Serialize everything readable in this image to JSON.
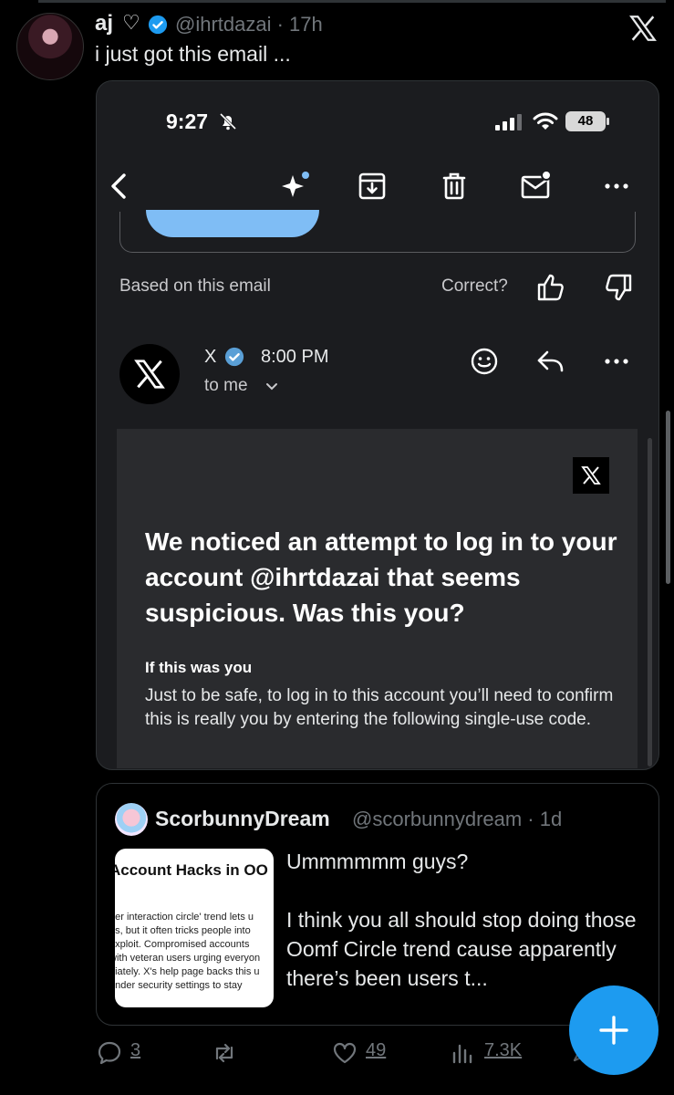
{
  "tweet": {
    "author_name": "aj",
    "author_emoji": "♡",
    "handle_time": "@ihrtdazai · 17h",
    "text": "i just got this email ..."
  },
  "phone_status": {
    "time": "9:27",
    "battery": "48"
  },
  "email_screen": {
    "based_label": "Based on this email",
    "correct_label": "Correct?",
    "sender_name": "X",
    "sender_time": "8:00 PM",
    "recipient": "to me",
    "headline": "We noticed an attempt to log in to your account @ihrtdazai that seems suspicious. Was this you?",
    "subheading": "If this was you",
    "paragraph": "Just to be safe, to log in to this account you’ll need to confirm this is really you by entering the following single-use code."
  },
  "quote": {
    "name": "ScorbunnyDream",
    "handle_time": "@scorbunnydream · 1d",
    "image_title": "Account Hacks in OO",
    "image_lines": [
      "tter interaction circle' trend lets u",
      "ns, but it often tricks people into",
      "exploit. Compromised accounts",
      "with veteran users urging everyon",
      "diately. X's help page backs this u",
      "under security settings to stay"
    ],
    "text": "Ummmmmm guys?\n\nI think you all should stop doing those Oomf Circle trend cause apparently there’s been users t..."
  },
  "actions": {
    "replies": "3",
    "likes": "49",
    "views": "7.3K"
  },
  "colors": {
    "accent": "#1d9bf0",
    "background": "#000000",
    "muted": "#71767b"
  }
}
